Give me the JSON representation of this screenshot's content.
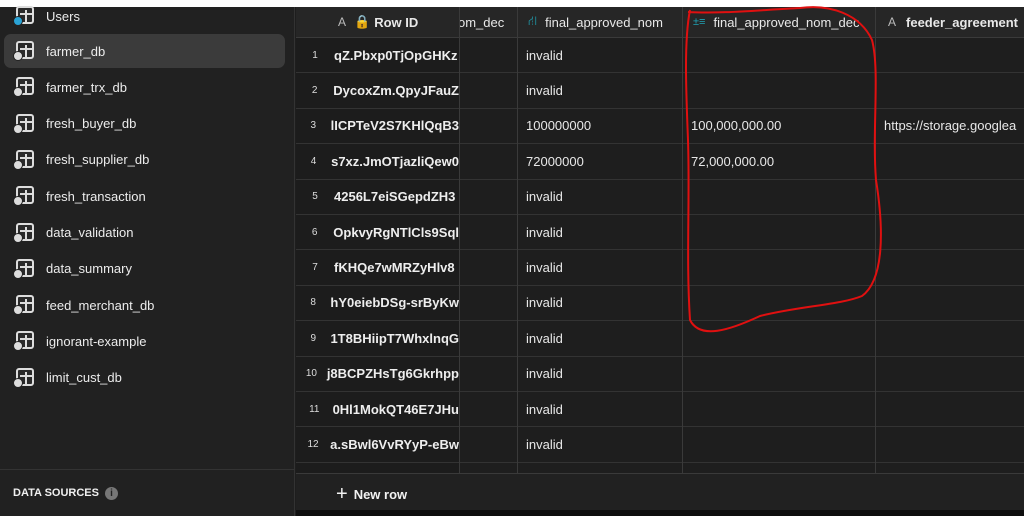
{
  "sidebar": {
    "items": [
      {
        "label": "Users",
        "icon": "table-users-icon",
        "active": false
      },
      {
        "label": "farmer_db",
        "icon": "table-link-icon",
        "active": true
      },
      {
        "label": "farmer_trx_db",
        "icon": "table-link-icon",
        "active": false
      },
      {
        "label": "fresh_buyer_db",
        "icon": "table-link-icon",
        "active": false
      },
      {
        "label": "fresh_supplier_db",
        "icon": "table-link-icon",
        "active": false
      },
      {
        "label": "fresh_transaction",
        "icon": "table-link-icon",
        "active": false
      },
      {
        "label": "data_validation",
        "icon": "table-link-icon",
        "active": false
      },
      {
        "label": "data_summary",
        "icon": "table-link-icon",
        "active": false
      },
      {
        "label": "feed_merchant_db",
        "icon": "table-link-icon",
        "active": false
      },
      {
        "label": "ignorant-example",
        "icon": "table-link-icon",
        "active": false
      },
      {
        "label": "limit_cust_db",
        "icon": "table-link-icon",
        "active": false
      }
    ],
    "data_sources": "DATA SOURCES",
    "info_icon": "i"
  },
  "grid": {
    "columns": [
      {
        "label": "Row ID",
        "type_icon": "A",
        "lock": true
      },
      {
        "label": "om_dec"
      },
      {
        "label": "final_approved_nom",
        "type_icon": "relation-icon"
      },
      {
        "label": "final_approved_nom_dec",
        "type_icon": "math-icon"
      },
      {
        "label": "feeder_agreement",
        "type_icon": "A"
      }
    ],
    "rows": [
      {
        "n": "1",
        "id": "qZ.Pbxp0TjOpGHKz",
        "nom": "invalid",
        "dec": "",
        "feeder": ""
      },
      {
        "n": "2",
        "id": "DycoxZm.QpyJFauZ",
        "nom": "invalid",
        "dec": "",
        "feeder": ""
      },
      {
        "n": "3",
        "id": "lICPTeV2S7KHlQqB3",
        "nom": "100000000",
        "dec": "100,000,000.00",
        "feeder": "https://storage.googlea"
      },
      {
        "n": "4",
        "id": "s7xz.JmOTjazliQew0",
        "nom": "72000000",
        "dec": "72,000,000.00",
        "feeder": ""
      },
      {
        "n": "5",
        "id": "4256L7eiSGepdZH3",
        "nom": "invalid",
        "dec": "",
        "feeder": ""
      },
      {
        "n": "6",
        "id": "OpkvyRgNTlCls9Sql",
        "nom": "invalid",
        "dec": "",
        "feeder": ""
      },
      {
        "n": "7",
        "id": "fKHQe7wMRZyHlv8",
        "nom": "invalid",
        "dec": "",
        "feeder": ""
      },
      {
        "n": "8",
        "id": "hY0eiebDSg-srByKw",
        "nom": "invalid",
        "dec": "",
        "feeder": ""
      },
      {
        "n": "9",
        "id": "1T8BHiipT7WhxlnqG",
        "nom": "invalid",
        "dec": "",
        "feeder": ""
      },
      {
        "n": "10",
        "id": "j8BCPZHsTg6Gkrhpp",
        "nom": "invalid",
        "dec": "",
        "feeder": ""
      },
      {
        "n": "11",
        "id": "0Hl1MokQT46E7JHu",
        "nom": "invalid",
        "dec": "",
        "feeder": ""
      },
      {
        "n": "12",
        "id": "a.sBwl6VvRYyP-eBw",
        "nom": "invalid",
        "dec": "",
        "feeder": ""
      }
    ],
    "new_row": "New row"
  },
  "colors": {
    "accent": "#1fa3b5",
    "annotation": "#e01010"
  }
}
